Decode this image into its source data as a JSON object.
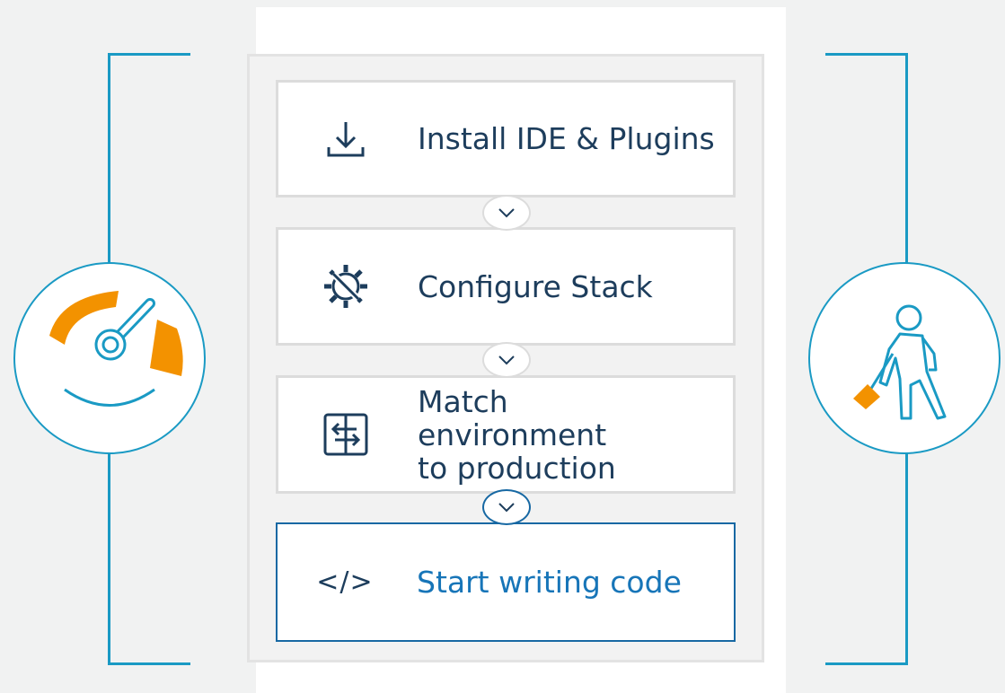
{
  "steps": [
    {
      "label": "Install IDE & Plugins",
      "icon": "download-icon",
      "active": false
    },
    {
      "label": "Configure Stack",
      "icon": "gear-wrench-icon",
      "active": false
    },
    {
      "label": "Match environment to production",
      "icon": "compare-arrows-icon",
      "active": false
    },
    {
      "label": "Start writing code",
      "icon": "code-icon",
      "active": true
    }
  ],
  "code_glyph": "</>",
  "left_icon": "speedometer-icon",
  "right_icon": "digging-worker-icon",
  "colors": {
    "bracket": "#1a9ac4",
    "accent": "#f39200",
    "text": "#1d3d5c",
    "active_text": "#1775b8",
    "active_border": "#1768a3"
  }
}
